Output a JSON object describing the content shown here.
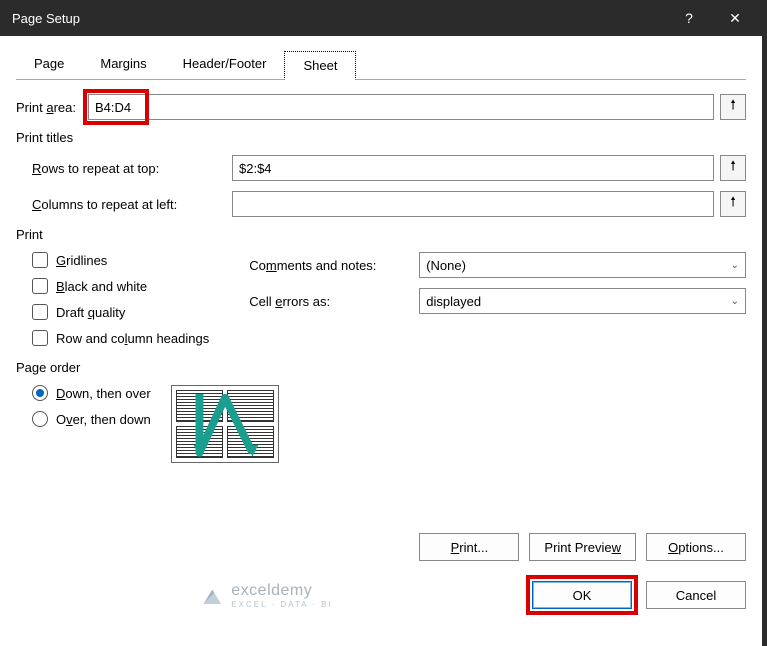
{
  "titlebar": {
    "title": "Page Setup",
    "help": "?",
    "close": "✕"
  },
  "tabs": {
    "page": "Page",
    "margins": "Margins",
    "headerfooter": "Header/Footer",
    "sheet": "Sheet"
  },
  "printarea": {
    "label_pre": "Print ",
    "label_u": "a",
    "label_post": "rea:",
    "value": "B4:D4"
  },
  "printtitles": {
    "heading": "Print titles",
    "rows_u": "R",
    "rows_post": "ows to repeat at top:",
    "rows_value": "$2:$4",
    "cols_u": "C",
    "cols_post": "olumns to repeat at left:",
    "cols_value": ""
  },
  "print": {
    "heading": "Print",
    "gridlines_u": "G",
    "gridlines_post": "ridlines",
    "bw_u": "B",
    "bw_post": "lack and white",
    "draft_pre": "Draft ",
    "draft_u": "q",
    "draft_post": "uality",
    "rch_pre": "Row and co",
    "rch_u": "l",
    "rch_post": "umn headings",
    "comments_pre": "Co",
    "comments_u": "m",
    "comments_post": "ments and notes:",
    "comments_value": "(None)",
    "errors_pre": "Cell ",
    "errors_u": "e",
    "errors_post": "rrors as:",
    "errors_value": "displayed"
  },
  "pageorder": {
    "heading": "Page order",
    "down_u": "D",
    "down_post": "own, then over",
    "over_pre": "O",
    "over_u": "v",
    "over_post": "er, then down"
  },
  "buttons": {
    "print_u": "P",
    "print_post": "rint...",
    "preview_pre": "Print Previe",
    "preview_u": "w",
    "options_u": "O",
    "options_post": "ptions..."
  },
  "footer": {
    "brand_name": "exceldemy",
    "brand_sub": "EXCEL · DATA · BI",
    "ok": "OK",
    "cancel": "Cancel"
  }
}
